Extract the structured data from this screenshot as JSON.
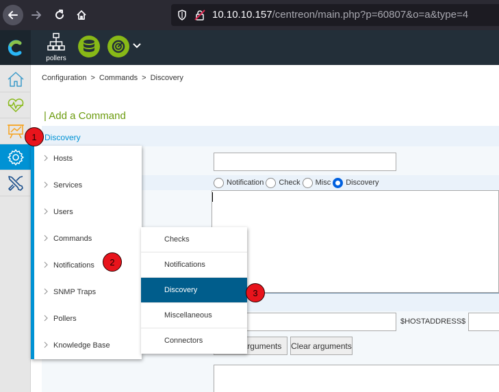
{
  "browser": {
    "url_host": "10.10.10.157",
    "url_path": "/centreon/main.php?p=60807&o=a&type=4"
  },
  "topbar": {
    "pollers_label": "pollers"
  },
  "sidebar": {
    "items": [
      {
        "name": "home",
        "icon": "home-icon"
      },
      {
        "name": "monitoring",
        "icon": "heartbeat-icon"
      },
      {
        "name": "reporting",
        "icon": "chart-board-icon"
      },
      {
        "name": "configuration",
        "icon": "gear-icon",
        "active": true
      },
      {
        "name": "administration",
        "icon": "tools-icon"
      }
    ]
  },
  "breadcrumb": [
    "Configuration",
    ">",
    "Commands",
    ">",
    "Discovery"
  ],
  "page": {
    "title": "| Add a Command",
    "section_label": "Discovery"
  },
  "form": {
    "command_types": [
      {
        "label": "Notification",
        "checked": false
      },
      {
        "label": "Check",
        "checked": false
      },
      {
        "label": "Misc",
        "checked": false
      },
      {
        "label": "Discovery",
        "checked": true
      }
    ],
    "macro_label": "$HOSTADDRESS$",
    "describe_button": "Describe arguments",
    "describe_visible": "arguments",
    "clear_button": "Clear arguments"
  },
  "menu": {
    "items": [
      "Hosts",
      "Services",
      "Users",
      "Commands",
      "Notifications",
      "SNMP Traps",
      "Pollers",
      "Knowledge Base"
    ]
  },
  "submenu": {
    "items": [
      "Checks",
      "Notifications",
      "Discovery",
      "Miscellaneous",
      "Connectors"
    ],
    "active_index": 2
  },
  "markers": [
    "1",
    "2",
    "3"
  ],
  "colors": {
    "accent": "#0092d4",
    "title_green": "#6a9a0c",
    "active_sub": "#005d8c",
    "marker_red": "#e8141c"
  }
}
